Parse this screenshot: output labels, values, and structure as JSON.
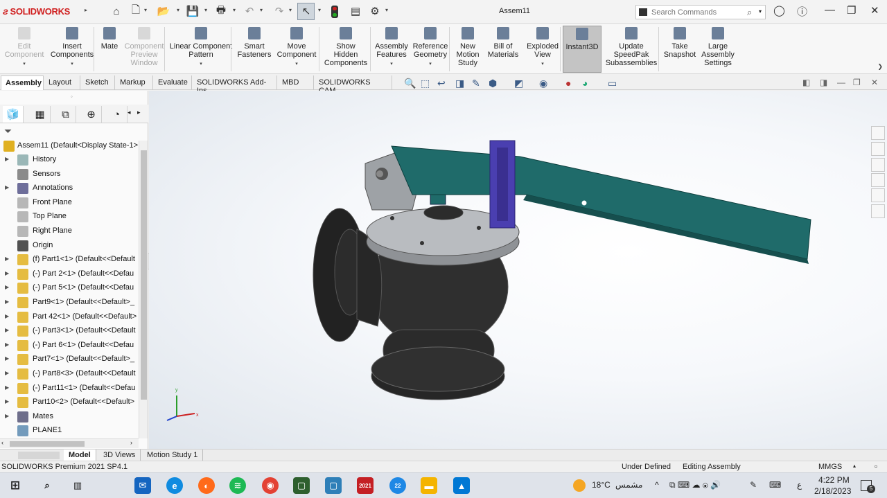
{
  "app": {
    "brand": "SOLIDWORKS",
    "doc_title": "Assem11"
  },
  "search": {
    "placeholder": "Search Commands"
  },
  "ribbon": [
    {
      "label": "Edit\nComponent",
      "disabled": true
    },
    {
      "label": "Insert\nComponents",
      "disabled": false
    },
    {
      "label": "Mate",
      "disabled": false
    },
    {
      "label": "Component\nPreview\nWindow",
      "disabled": true
    },
    {
      "label": "Linear Component\nPattern",
      "disabled": false
    },
    {
      "label": "Smart\nFasteners",
      "disabled": false
    },
    {
      "label": "Move\nComponent",
      "disabled": false
    },
    {
      "label": "Show\nHidden\nComponents",
      "disabled": false
    },
    {
      "label": "Assembly\nFeatures",
      "disabled": false
    },
    {
      "label": "Reference\nGeometry",
      "disabled": false
    },
    {
      "label": "New\nMotion\nStudy",
      "disabled": false
    },
    {
      "label": "Bill of\nMaterials",
      "disabled": false
    },
    {
      "label": "Exploded\nView",
      "disabled": false
    },
    {
      "label": "Instant3D",
      "disabled": false,
      "active": true
    },
    {
      "label": "Update\nSpeedPak\nSubassemblies",
      "disabled": false
    },
    {
      "label": "Take\nSnapshot",
      "disabled": false
    },
    {
      "label": "Large\nAssembly\nSettings",
      "disabled": false
    }
  ],
  "tabs": [
    "Assembly",
    "Layout",
    "Sketch",
    "Markup",
    "Evaluate",
    "SOLIDWORKS Add-Ins",
    "MBD",
    "SOLIDWORKS CAM"
  ],
  "active_tab": "Assembly",
  "tree": {
    "root": "Assem11  (Default<Display State-1>",
    "items": [
      {
        "label": "History",
        "icon": "history-icon",
        "expandable": true
      },
      {
        "label": "Sensors",
        "icon": "sensor-icon",
        "expandable": false
      },
      {
        "label": "Annotations",
        "icon": "annotation-icon",
        "expandable": true
      },
      {
        "label": "Front Plane",
        "icon": "plane-icon",
        "expandable": false
      },
      {
        "label": "Top Plane",
        "icon": "plane-icon",
        "expandable": false
      },
      {
        "label": "Right Plane",
        "icon": "plane-icon",
        "expandable": false
      },
      {
        "label": "Origin",
        "icon": "origin-icon",
        "expandable": false
      },
      {
        "label": "(f) Part1<1> (Default<<Default",
        "icon": "part-icon",
        "expandable": true
      },
      {
        "label": "(-) Part 2<1> (Default<<Defau",
        "icon": "part-icon",
        "expandable": true
      },
      {
        "label": "(-) Part 5<1> (Default<<Defau",
        "icon": "part-icon",
        "expandable": true
      },
      {
        "label": "Part9<1> (Default<<Default>_",
        "icon": "part-icon",
        "expandable": true
      },
      {
        "label": "Part 42<1> (Default<<Default>",
        "icon": "part-icon",
        "expandable": true
      },
      {
        "label": "(-) Part3<1> (Default<<Default",
        "icon": "part-icon",
        "expandable": true
      },
      {
        "label": "(-) Part 6<1> (Default<<Defau",
        "icon": "part-icon",
        "expandable": true
      },
      {
        "label": "Part7<1> (Default<<Default>_",
        "icon": "part-icon",
        "expandable": true
      },
      {
        "label": "(-) Part8<3> (Default<<Default",
        "icon": "part-icon",
        "expandable": true
      },
      {
        "label": "(-) Part11<1> (Default<<Defau",
        "icon": "part-icon",
        "expandable": true
      },
      {
        "label": "Part10<2> (Default<<Default>",
        "icon": "part-icon",
        "expandable": true
      },
      {
        "label": "Mates",
        "icon": "mates-icon",
        "expandable": true
      },
      {
        "label": "PLANE1",
        "icon": "plane-part-icon",
        "expandable": false
      }
    ]
  },
  "triad": {
    "x": "x",
    "y": "y"
  },
  "bottom_tabs": [
    "Model",
    "3D Views",
    "Motion Study 1"
  ],
  "status": {
    "product": "SOLIDWORKS Premium 2021 SP4.1",
    "definition": "Under Defined",
    "mode": "Editing Assembly",
    "units": "MMGS"
  },
  "taskbar": {
    "weather": "18°C",
    "weather_label": "مشمس",
    "lang": "ع",
    "time": "4:22 PM",
    "date": "2/18/2023",
    "notifications": "5",
    "badge": "22",
    "sw_badge": "2021"
  },
  "colors": {
    "brand_red": "#d02020",
    "lever": "#1f6b6a",
    "bracket": "#4a3fb0",
    "body": "#2c2c2c",
    "plate": "#b9bcc0"
  }
}
